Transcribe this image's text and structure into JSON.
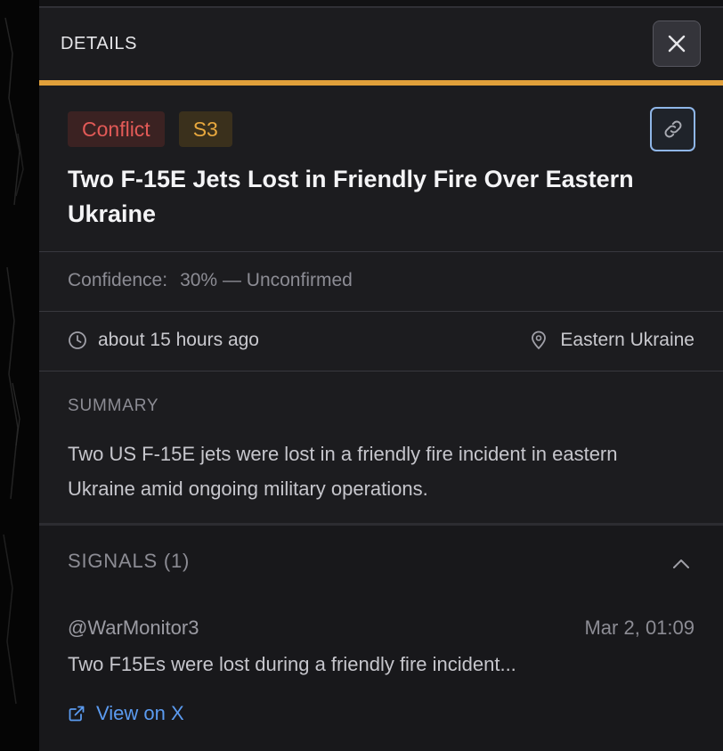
{
  "panel": {
    "header_title": "DETAILS",
    "close_icon": "close-icon"
  },
  "event": {
    "category_tag": "Conflict",
    "severity_tag": "S3",
    "link_icon": "link-icon",
    "title": "Two F-15E Jets Lost in Friendly Fire Over Eastern Ukraine",
    "confidence_label": "Confidence:",
    "confidence_value": "30% — Unconfirmed",
    "time": "about 15 hours ago",
    "location": "Eastern Ukraine",
    "summary_label": "SUMMARY",
    "summary": "Two US F-15E jets were lost in a friendly fire incident in eastern Ukraine amid ongoing military operations."
  },
  "signals": {
    "label": "SIGNALS (1)",
    "items": [
      {
        "author": "@WarMonitor3",
        "date": "Mar 2, 01:09",
        "text": "Two F15Es were lost during a friendly fire incident...",
        "link_label": "View on X"
      }
    ]
  },
  "colors": {
    "accent": "#e0a03a",
    "conflict": "#e25a57",
    "severity": "#e8a83e",
    "link": "#5b9bf0"
  }
}
